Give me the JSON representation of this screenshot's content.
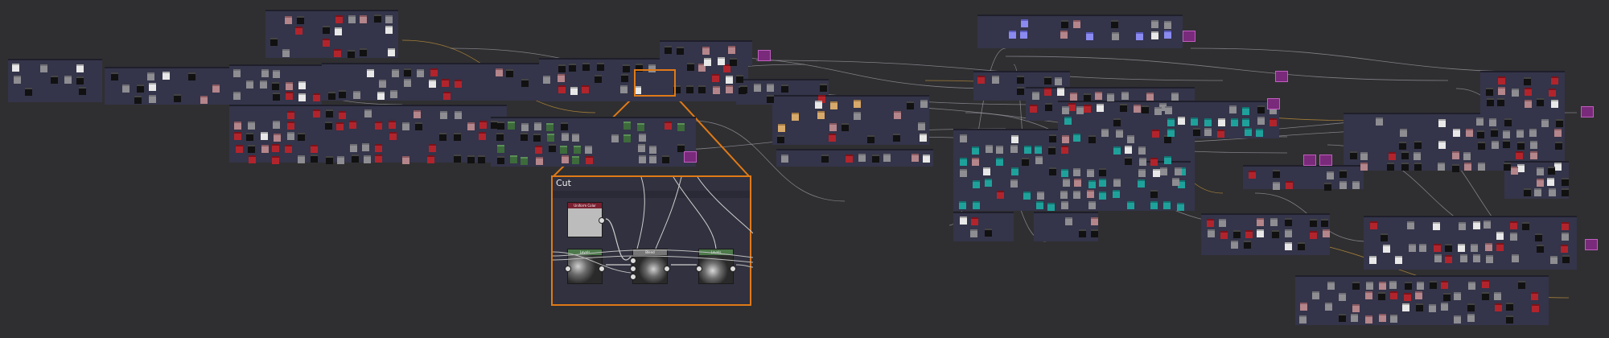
{
  "app": {
    "view": "node-graph-editor"
  },
  "zoom_frame": {
    "title": "Cut",
    "nodes": [
      {
        "label": "Uniform Color",
        "type": "uniform-color"
      },
      {
        "label": "Levels",
        "type": "levels"
      },
      {
        "label": "Blend",
        "type": "blend"
      },
      {
        "label": "Levels",
        "type": "levels"
      }
    ]
  },
  "colors": {
    "background": "#2f2f31",
    "frame": "#34344a",
    "selection": "#e07a16",
    "wire": "#9b9ba3",
    "node_red": "#b2242c",
    "node_teal": "#1fa19b",
    "node_purple": "#8a8af0",
    "node_green_header": "#5b8f57",
    "output_magenta": "#7a2a7a"
  }
}
